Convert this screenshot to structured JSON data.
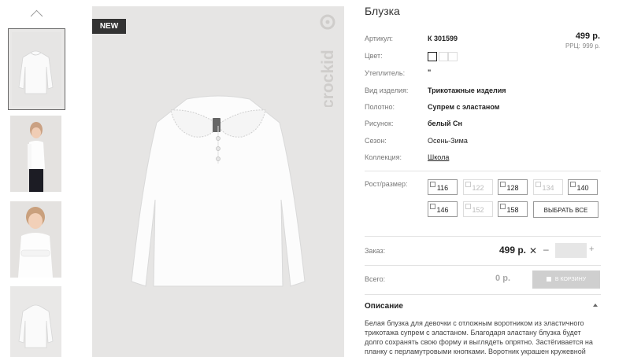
{
  "gallery": {
    "up_icon": "chevron-up-icon",
    "badge": "NEW",
    "brand": "crockid"
  },
  "product": {
    "title": "Блузка",
    "price": "499 р.",
    "rrc_label": "РРЦ:",
    "rrc_value": "999 р.",
    "fields": {
      "article": {
        "label": "Артикул:",
        "value": "К 301599"
      },
      "color": {
        "label": "Цвет:"
      },
      "insulation": {
        "label": "Утеплитель:",
        "value": "\""
      },
      "type": {
        "label": "Вид изделия:",
        "value": "Трикотажные изделия"
      },
      "fabric": {
        "label": "Полотно:",
        "value": "Супрем с эластаном"
      },
      "pattern": {
        "label": "Рисунок:",
        "value": "белый Сн"
      },
      "season": {
        "label": "Сезон:",
        "value": "Осень-Зима"
      },
      "collection": {
        "label": "Коллекция:",
        "value": "Школа"
      }
    },
    "sizes_label": "Рост/размер:",
    "sizes": [
      {
        "label": "116",
        "enabled": true
      },
      {
        "label": "122",
        "enabled": false
      },
      {
        "label": "128",
        "enabled": true
      },
      {
        "label": "134",
        "enabled": false
      },
      {
        "label": "140",
        "enabled": true
      },
      {
        "label": "146",
        "enabled": true
      },
      {
        "label": "152",
        "enabled": false
      },
      {
        "label": "158",
        "enabled": true
      }
    ],
    "select_all": "ВЫБРАТЬ ВСЕ"
  },
  "order": {
    "label": "Заказ:",
    "total": "499 р.",
    "remove_icon": "close-icon",
    "minus": "–",
    "plus": "+",
    "quantity": ""
  },
  "summary": {
    "label": "Всего:",
    "total": "0 р.",
    "cart_button": "В КОРЗИНУ"
  },
  "description": {
    "title": "Описание",
    "text": "Белая блузка для девочки с отложным воротником из эластичного трикотажа супрем с эластаном. Благодаря эластану блузка будет долго сохранять свою форму и выглядеть опрятно. Застёгивается на планку с перламутровыми кнопками. Воротник украшен кружевной"
  }
}
